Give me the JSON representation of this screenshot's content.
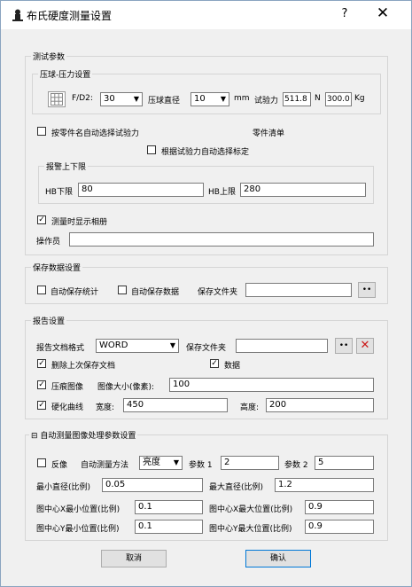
{
  "window": {
    "title": "布氏硬度测量设置",
    "help": "?",
    "close": "✕"
  },
  "test_params": {
    "legend": "测试参数",
    "indenter": {
      "legend": "压球-压力设置",
      "fd2_label": "F/D2:",
      "fd2_value": "30",
      "ball_dia_label": "压球直径",
      "ball_dia_value": "10",
      "mm_label": "mm",
      "force_label": "试验力",
      "force_value": "511.8",
      "n_label": "N",
      "kg_value": "300.0",
      "kg_label": "Kg"
    },
    "auto_select_label": "按零件名自动选择试验力",
    "parts_list_label": "零件清单",
    "auto_standard_label": "根据试验力自动选择标定",
    "alarm": {
      "legend": "报警上下限",
      "lower_label": "HB下限",
      "lower_value": "80",
      "upper_label": "HB上限",
      "upper_value": "280"
    },
    "show_album_label": "测量时显示相册",
    "show_album_checked": "✓",
    "operator_label": "操作员",
    "operator_value": ""
  },
  "save": {
    "legend": "保存数据设置",
    "auto_stats_label": "自动保存统计",
    "auto_data_label": "自动保存数据",
    "folder_label": "保存文件夹",
    "folder_value": "",
    "browse": "••"
  },
  "report": {
    "legend": "报告设置",
    "format_label": "报告文档格式",
    "format_value": "WORD",
    "folder_label": "保存文件夹",
    "folder_value": "",
    "browse": "••",
    "delete_icon": "✕",
    "delete_last_label": "删除上次保存文档",
    "data_label": "数据",
    "indent_img_label": "压痕图像",
    "img_size_label": "图像大小(像素):",
    "img_size_value": "100",
    "hardness_curve_label": "硬化曲线",
    "width_label": "宽度:",
    "width_value": "450",
    "height_label": "高度:",
    "height_value": "200",
    "check_mark": "✓"
  },
  "auto_measure": {
    "legend": "自动测量图像处理参数设置",
    "collapse": "⊟",
    "invert_label": "反像",
    "method_label": "自动测量方法",
    "method_value": "亮度",
    "param1_label": "参数 1",
    "param1_value": "2",
    "param2_label": "参数 2",
    "param2_value": "5",
    "min_dia_label": "最小直径(比例)",
    "min_dia_value": "0.05",
    "max_dia_label": "最大直径(比例)",
    "max_dia_value": "1.2",
    "cx_min_label": "图中心X最小位置(比例)",
    "cx_min_value": "0.1",
    "cx_max_label": "图中心X最大位置(比例)",
    "cx_max_value": "0.9",
    "cy_min_label": "图中心Y最小位置(比例)",
    "cy_min_value": "0.1",
    "cy_max_label": "图中心Y最大位置(比例)",
    "cy_max_value": "0.9"
  },
  "footer": {
    "cancel": "取消",
    "ok": "确认"
  },
  "colors": {
    "delete_icon": "#cc1a1a",
    "border": "#d5d5d5"
  }
}
